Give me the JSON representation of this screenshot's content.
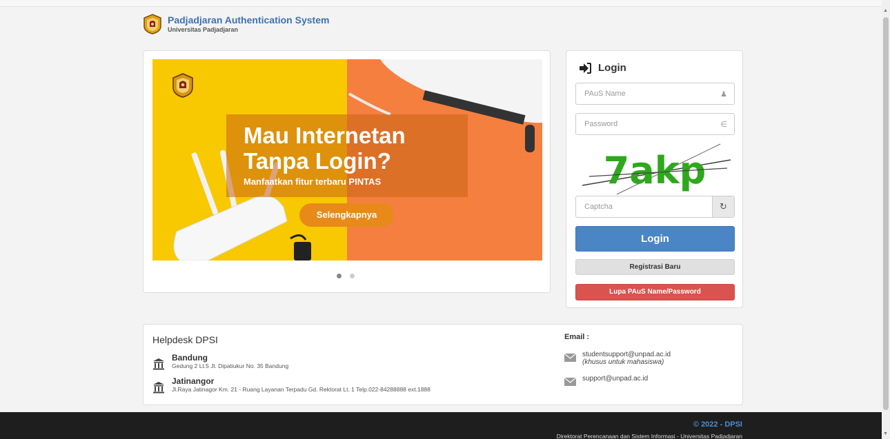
{
  "header": {
    "title": "Padjadjaran Authentication System",
    "subtitle": "Universitas Padjadjaran"
  },
  "carousel": {
    "headline_line1": "Mau Internetan",
    "headline_line2": "Tanpa Login?",
    "subheadline": "Manfaatkan fitur terbaru PINTAS",
    "button_label": "Selengkapnya",
    "slide_count": 2,
    "active_slide": 1
  },
  "login": {
    "title": "Login",
    "username_placeholder": "PAuS Name",
    "password_placeholder": "Password",
    "captcha_text": "7akp",
    "captcha_placeholder": "Captcha",
    "login_button": "Login",
    "register_button": "Registrasi Baru",
    "forgot_button": "Lupa PAuS Name/Password"
  },
  "helpdesk": {
    "title": "Helpdesk DPSI",
    "locations": [
      {
        "name": "Bandung",
        "address": "Gedung 2 Lt.5 Jl. Dipatiukur No. 35 Bandung"
      },
      {
        "name": "Jatinangor",
        "address": "Jl.Raya Jatinagor Km. 21 - Ruang Layanan Terpadu Gd. Rektorat Lt. 1 Telp.022-84288888 ext.1888"
      }
    ],
    "email_label": "Email :",
    "emails": [
      {
        "address": "studentsupport@unpad.ac.id",
        "note": "(khusus untuk mahasiswa)"
      },
      {
        "address": "support@unpad.ac.id"
      }
    ]
  },
  "footer": {
    "copyright": "© 2022 - DPSI",
    "organization": "Direktorat Perencanaan dan Sistem Informasi - Universitas Padjadjaran"
  },
  "colors": {
    "brand_blue": "#3c72ad",
    "login_button": "#4a86c5",
    "forgot_button": "#d9534f",
    "slide_yellow": "#f8c800",
    "slide_orange": "#f57f3f",
    "footer_bg": "#1e1e1e"
  }
}
